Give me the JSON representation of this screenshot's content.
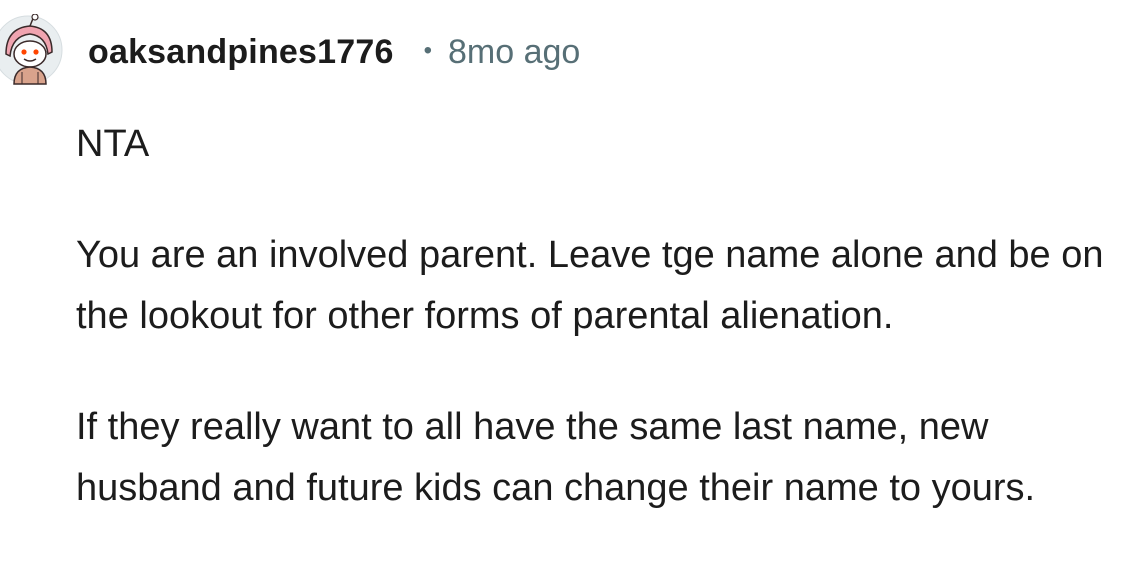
{
  "comment": {
    "username": "oaksandpines1776",
    "separator": "•",
    "timestamp": "8mo ago",
    "avatar_icon": "snoo-avatar-icon",
    "paragraphs": [
      "NTA",
      "You are an involved parent. Leave tge name alone and be on the lookout for other forms of parental alienation.",
      "If they really want to all have the same last name, new husband and future kids can change their name to yours."
    ]
  },
  "colors": {
    "text": "#1c1c1c",
    "meta": "#576f76",
    "background": "#ffffff"
  }
}
